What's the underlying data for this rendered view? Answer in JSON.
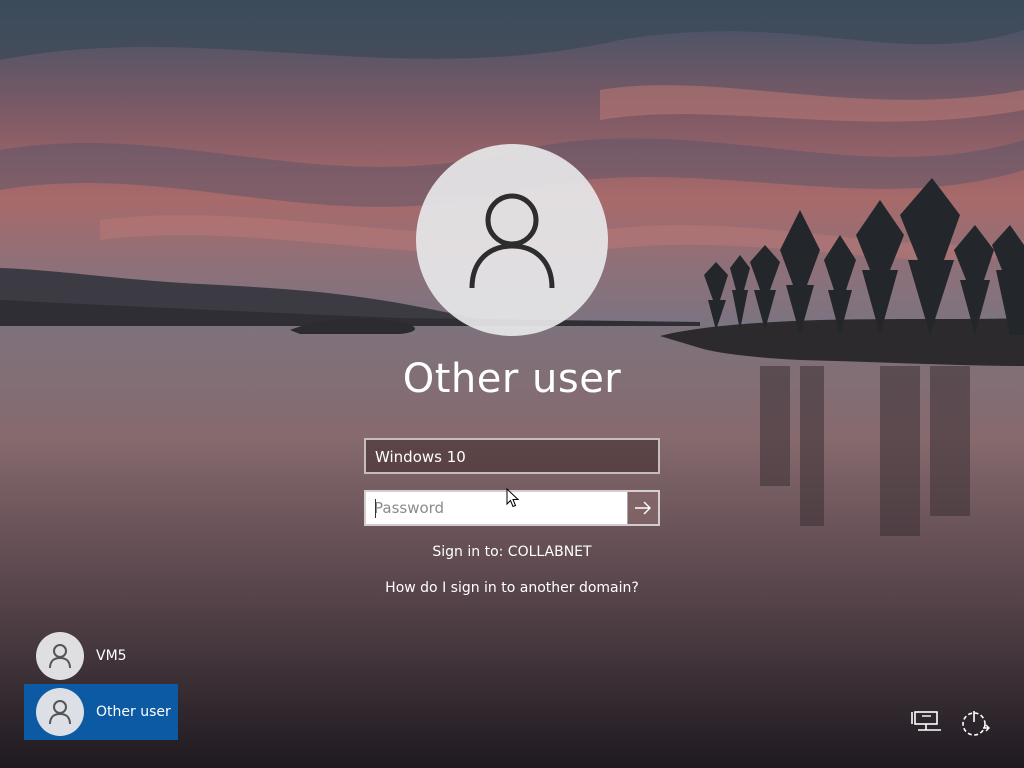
{
  "main": {
    "avatar_icon": "user-silhouette-icon",
    "title": "Other user",
    "username_value": "Windows 10",
    "password": {
      "value": "",
      "placeholder": "Password",
      "submit_icon": "arrow-right-icon"
    },
    "sign_in_to": "Sign in to: COLLABNET",
    "help_link": "How do I sign in to another domain?"
  },
  "user_list": {
    "items": [
      {
        "label": "VM5",
        "icon": "user-silhouette-icon",
        "selected": false
      },
      {
        "label": "Other user",
        "icon": "user-silhouette-icon",
        "selected": true
      }
    ]
  },
  "corner_icons": {
    "network": "network-icon",
    "power": "power-icon"
  },
  "colors": {
    "selected_tile": "#0b5aa3",
    "text": "#ffffff",
    "avatar_bg": "#e6e6e8"
  }
}
